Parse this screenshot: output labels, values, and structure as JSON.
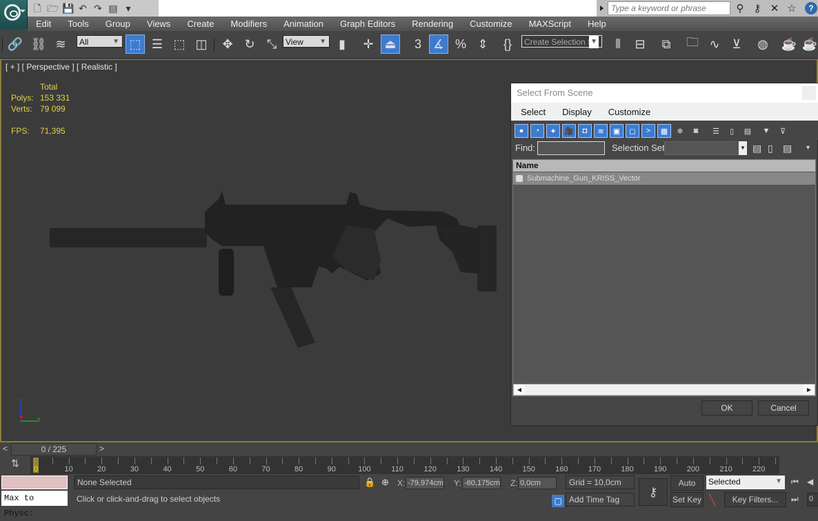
{
  "quick_access": {
    "icons": [
      "new-file-icon",
      "open-folder-icon",
      "save-icon",
      "undo-icon",
      "redo-icon",
      "project-folder-icon",
      "customize-dropdown-icon"
    ]
  },
  "search": {
    "placeholder": "Type a keyword or phrase"
  },
  "menu": {
    "items": [
      "Edit",
      "Tools",
      "Group",
      "Views",
      "Create",
      "Modifiers",
      "Animation",
      "Graph Editors",
      "Rendering",
      "Customize",
      "MAXScript",
      "Help"
    ]
  },
  "toolbar": {
    "filter_select": "All",
    "reference_coord_select": "View",
    "angle_snap_label": "3",
    "named_selection_placeholder": "Create Selection Se"
  },
  "viewport": {
    "label": "[ + ] [ Perspective ] [ Realistic ]",
    "stats": {
      "header": "Total",
      "polys_label": "Polys:",
      "polys_value": "153 331",
      "verts_label": "Verts:",
      "verts_value": "79 099",
      "fps_label": "FPS:",
      "fps_value": "71,395"
    },
    "axis": {
      "z": "z",
      "y": "y"
    }
  },
  "dialog": {
    "title": "Select From Scene",
    "menu": [
      "Select",
      "Display",
      "Customize"
    ],
    "find_label": "Find:",
    "find_value": "",
    "selection_set_label": "Selection Set:",
    "selection_set_value": "",
    "column_header": "Name",
    "rows": [
      {
        "name": "Submachine_Gun_KRISS_Vector"
      }
    ],
    "ok_label": "OK",
    "cancel_label": "Cancel"
  },
  "timeline": {
    "slider_text": "0 / 225",
    "prev": "<",
    "next": ">",
    "current_frame": 0,
    "total_frames": 225,
    "labels": [
      0,
      10,
      20,
      30,
      40,
      50,
      60,
      70,
      80,
      90,
      100,
      110,
      120,
      130,
      140,
      150,
      160,
      170,
      180,
      190,
      200,
      210,
      220
    ]
  },
  "status": {
    "maxscript_listener": "Max to Physc:",
    "selection": "None Selected",
    "prompt": "Click or click-and-drag to select objects",
    "x_label": "X:",
    "x_value": "-79,974cm",
    "y_label": "Y:",
    "y_value": "-60,175cm",
    "z_label": "Z:",
    "z_value": "0,0cm",
    "grid": "Grid = 10,0cm",
    "add_time_tag": "Add Time Tag",
    "auto_key": "Auto Key",
    "set_key": "Set Key",
    "key_mode_select": "Selected",
    "key_filters": "Key Filters...",
    "frame_field": "0"
  }
}
